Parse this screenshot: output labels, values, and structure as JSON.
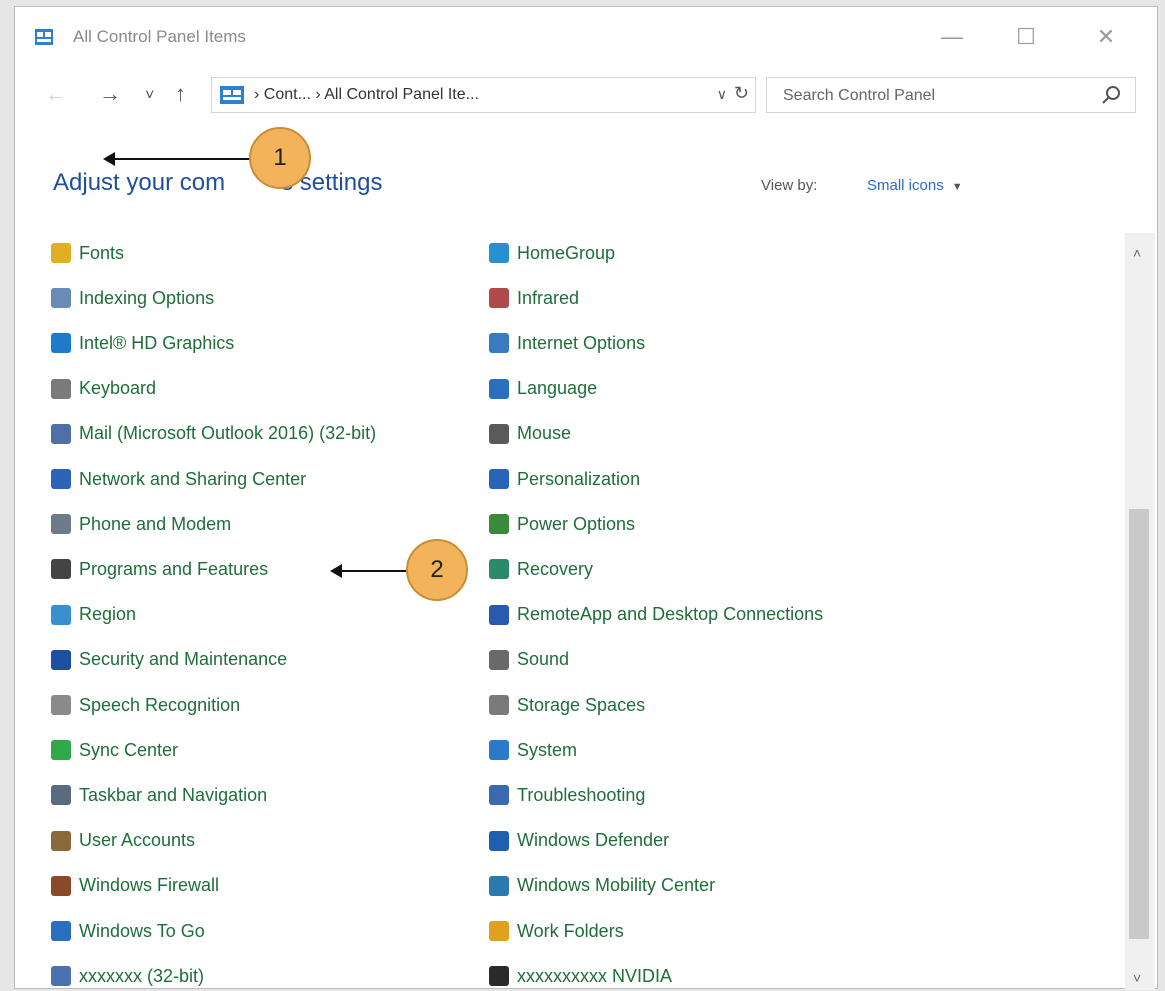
{
  "window": {
    "title": "All Control Panel Items",
    "minimize_glyph": "—",
    "maximize_glyph": "☐",
    "close_glyph": "✕"
  },
  "nav": {
    "back_glyph": "←",
    "forward_glyph": "→",
    "recent_glyph": "˅",
    "up_glyph": "↑",
    "breadcrumb": "› Cont... › All Control Panel Ite...",
    "dropdown_glyph": "∨",
    "refresh_glyph": "↻"
  },
  "search": {
    "placeholder": "Search Control Panel"
  },
  "main": {
    "heading_part1": "Adjust your com",
    "heading_part2": "s settings",
    "view_by_label": "View by:",
    "view_by_value": "Small icons"
  },
  "callouts": {
    "one": "1",
    "two": "2"
  },
  "scroll": {
    "up_glyph": "˄",
    "down_glyph": "˅"
  },
  "items_left": [
    {
      "label": "Fonts",
      "icon": "fonts-icon",
      "color": "#e0b020"
    },
    {
      "label": "Indexing Options",
      "icon": "indexing-icon",
      "color": "#6a8bb5"
    },
    {
      "label": "Intel® HD Graphics",
      "icon": "intel-graphics-icon",
      "color": "#1f7ac9"
    },
    {
      "label": "Keyboard",
      "icon": "keyboard-icon",
      "color": "#7a7a7a"
    },
    {
      "label": "Mail (Microsoft Outlook 2016) (32-bit)",
      "icon": "mail-icon",
      "color": "#4f6fa8"
    },
    {
      "label": "Network and Sharing Center",
      "icon": "network-icon",
      "color": "#2d64b8"
    },
    {
      "label": "Phone and Modem",
      "icon": "phone-icon",
      "color": "#6d7a8a"
    },
    {
      "label": "Programs and Features",
      "icon": "programs-icon",
      "color": "#444444"
    },
    {
      "label": "Region",
      "icon": "region-icon",
      "color": "#3a8fd0"
    },
    {
      "label": "Security and Maintenance",
      "icon": "flag-icon",
      "color": "#1f4fa0"
    },
    {
      "label": "Speech Recognition",
      "icon": "microphone-icon",
      "color": "#8a8a8a"
    },
    {
      "label": "Sync Center",
      "icon": "sync-icon",
      "color": "#2fa84a"
    },
    {
      "label": "Taskbar and Navigation",
      "icon": "taskbar-icon",
      "color": "#5a6b80"
    },
    {
      "label": "User Accounts",
      "icon": "users-icon",
      "color": "#8a6a3a"
    },
    {
      "label": "Windows Firewall",
      "icon": "firewall-icon",
      "color": "#8a4a2a"
    },
    {
      "label": "Windows To Go",
      "icon": "windows-to-go-icon",
      "color": "#2a6fc0"
    },
    {
      "label": "xxxxxxx (32-bit)",
      "icon": "app-icon",
      "color": "#4a72b0"
    }
  ],
  "items_right": [
    {
      "label": "HomeGroup",
      "icon": "homegroup-icon",
      "color": "#2a8fd0"
    },
    {
      "label": "Infrared",
      "icon": "infrared-icon",
      "color": "#b04a4a"
    },
    {
      "label": "Internet Options",
      "icon": "internet-options-icon",
      "color": "#3a7ac0"
    },
    {
      "label": "Language",
      "icon": "language-icon",
      "color": "#2a6fc0"
    },
    {
      "label": "Mouse",
      "icon": "mouse-icon",
      "color": "#5a5a5a"
    },
    {
      "label": "Personalization",
      "icon": "personalization-icon",
      "color": "#2a64b8"
    },
    {
      "label": "Power Options",
      "icon": "power-icon",
      "color": "#3a8a3a"
    },
    {
      "label": "Recovery",
      "icon": "recovery-icon",
      "color": "#2a8a6a"
    },
    {
      "label": "RemoteApp and Desktop Connections",
      "icon": "remoteapp-icon",
      "color": "#2a5ab0"
    },
    {
      "label": "Sound",
      "icon": "speaker-icon",
      "color": "#6a6a6a"
    },
    {
      "label": "Storage Spaces",
      "icon": "storage-icon",
      "color": "#7a7a7a"
    },
    {
      "label": "System",
      "icon": "system-icon",
      "color": "#2a7ac9"
    },
    {
      "label": "Troubleshooting",
      "icon": "troubleshooting-icon",
      "color": "#3a6ab0"
    },
    {
      "label": "Windows Defender",
      "icon": "defender-icon",
      "color": "#1f5fb0"
    },
    {
      "label": "Windows Mobility Center",
      "icon": "mobility-icon",
      "color": "#2a7ab0"
    },
    {
      "label": "Work Folders",
      "icon": "work-folders-icon",
      "color": "#e0a020"
    },
    {
      "label": "xxxxxxxxxx NVIDIA",
      "icon": "nvidia-icon",
      "color": "#2a2a2a"
    }
  ]
}
